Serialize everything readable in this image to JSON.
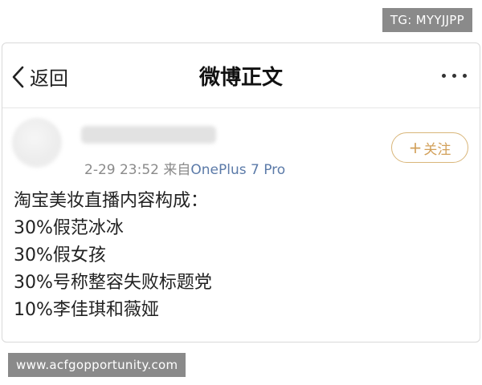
{
  "tg_badge": "TG: MYYJJPP",
  "navbar": {
    "back_label": "返回",
    "title": "微博正文"
  },
  "post": {
    "timestamp": "2-29 23:52",
    "source_prefix": "来自",
    "device": "OnePlus 7 Pro",
    "follow_label": "关注",
    "content_lines": [
      "淘宝美妆直播内容构成：",
      "30%假范冰冰",
      "30%假女孩",
      "30%号称整容失败标题党",
      "10%李佳琪和薇娅"
    ]
  },
  "watermark": "www.acfgopportunity.com",
  "colors": {
    "follow_accent": "#d2a05a",
    "device_link": "#5b7aa8",
    "meta_gray": "#8a8a8a"
  }
}
